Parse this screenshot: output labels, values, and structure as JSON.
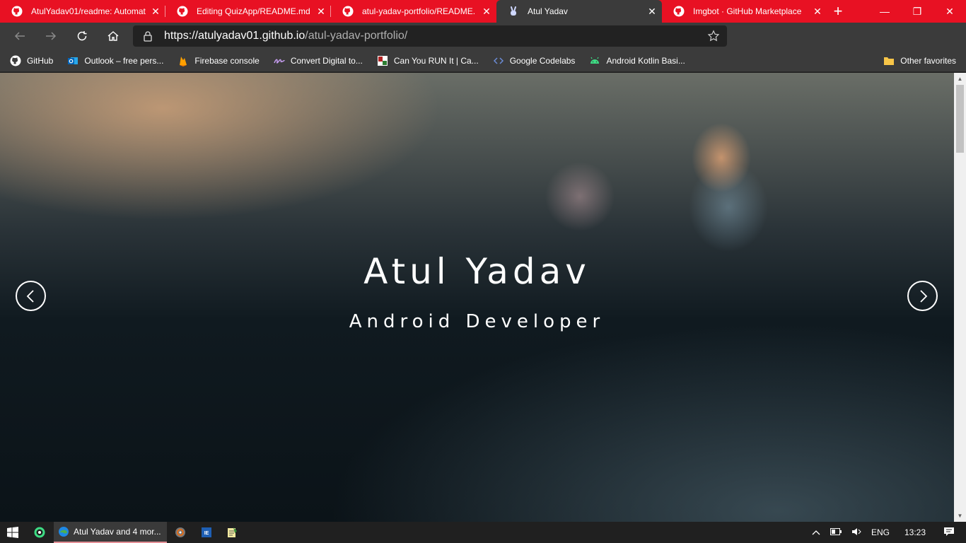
{
  "browser": {
    "tabs": [
      {
        "title": "AtulYadav01/readme: Automat",
        "icon": "github-icon",
        "active": false
      },
      {
        "title": "Editing QuizApp/README.md",
        "icon": "github-icon",
        "active": false
      },
      {
        "title": "atul-yadav-portfolio/README.",
        "icon": "github-icon",
        "active": false
      },
      {
        "title": "Atul Yadav",
        "icon": "peace-hand-icon",
        "active": true
      },
      {
        "title": "Imgbot · GitHub Marketplace",
        "icon": "github-icon",
        "active": false
      }
    ],
    "address": {
      "url_main": "https://atulyadav01.github.io",
      "url_rest": "/atul-yadav-portfolio/"
    },
    "bookmarks": [
      {
        "label": "GitHub",
        "icon": "github-icon"
      },
      {
        "label": "Outlook – free pers...",
        "icon": "outlook-icon"
      },
      {
        "label": "Firebase console",
        "icon": "firebase-icon"
      },
      {
        "label": "Convert Digital to...",
        "icon": "signature-icon"
      },
      {
        "label": "Can You RUN It | Ca...",
        "icon": "system-check-icon"
      },
      {
        "label": "Google Codelabs",
        "icon": "code-brackets-icon"
      },
      {
        "label": "Android Kotlin Basi...",
        "icon": "android-icon"
      }
    ],
    "other_favorites": "Other favorites"
  },
  "hero": {
    "name": "Atul Yadav",
    "role": "Android Developer"
  },
  "taskbar": {
    "browser_label": "Atul Yadav and 4 mor...",
    "language": "ENG",
    "time": "13:23"
  },
  "colors": {
    "tab_strip": "#e81123",
    "toolbar": "#3b3b3b",
    "taskbar": "#202020"
  }
}
